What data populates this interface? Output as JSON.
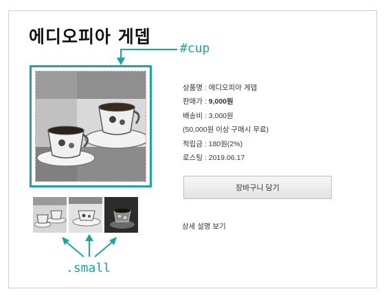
{
  "product": {
    "title": "에디오피아 게뎁",
    "info": {
      "name_label": "상품명 : ",
      "name_value": "에디오피아 게뎁",
      "price_label": "판매가 : ",
      "price_value": "9,000원",
      "shipping_label": "배송비 : ",
      "shipping_value": "3,000원",
      "shipping_note": "(50,000원 이상 구매시 무료)",
      "points_label": "적립금 : ",
      "points_value": "180원(2%)",
      "roasting_label": "로스팅 : ",
      "roasting_value": "2019.06.17"
    },
    "cart_button_label": "장바구니 담기",
    "detail_link_label": "상세 설명 보기",
    "main_image_icon": "coffee-cups-photo",
    "thumbnail_icons": [
      "coffee-cups-thumbnail",
      "coffee-cups-thumbnail",
      "coffee-cups-thumbnail"
    ]
  },
  "annotations": {
    "cup_label": "#cup",
    "small_label": ".small",
    "accent_color": "#16a7a4",
    "guide_color": "#b9a6d8"
  }
}
